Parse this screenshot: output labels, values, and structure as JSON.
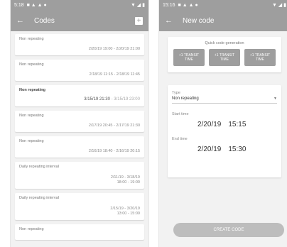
{
  "left": {
    "status": {
      "time": "5:18"
    },
    "appbar": {
      "back_icon": "arrow-left-icon",
      "title": "Codes",
      "add_icon": "plus-box-icon"
    },
    "codes": [
      {
        "title": "Non repeating",
        "dates": "2/20/19 19:00 - 2/20/19 21:00"
      },
      {
        "title": "Non repeating",
        "dates": "2/18/19 11:15 - 2/18/19 11:45"
      },
      {
        "title": "Non repeating",
        "dates": "3/15/19 21:30",
        "dates_end": " - 3/15/19 23:00"
      },
      {
        "title": "Non repeating",
        "dates": "2/17/19 20:45 - 2/17/19 21:30"
      },
      {
        "title": "Non repeating",
        "dates": "2/16/19 18:40 - 2/16/19 20:15"
      },
      {
        "title": "Daily repeating interval",
        "dates": "2/11/19 - 3/18/19\n18:00 - 19:00"
      },
      {
        "title": "Daily repeating interval",
        "dates": "2/15/19 - 3/20/19\n13:00 - 15:00"
      },
      {
        "title": "Non repeating",
        "dates": ""
      }
    ]
  },
  "right": {
    "status": {
      "time": "15:16"
    },
    "appbar": {
      "back_icon": "arrow-left-icon",
      "title": "New code"
    },
    "quick": {
      "label": "Quick code generation",
      "buttons": [
        "+1 TRANSIT TIME",
        "+1 TRANSIT TIME",
        "+1 TRANSIT TIME"
      ]
    },
    "form": {
      "type_label": "Type",
      "type_value": "Non repeating",
      "start_label": "Start time",
      "start_date": "2/20/19",
      "start_time": "15:15",
      "end_label": "End time",
      "end_date": "2/20/19",
      "end_time": "15:30"
    },
    "generate_label": "CREATE CODE"
  }
}
